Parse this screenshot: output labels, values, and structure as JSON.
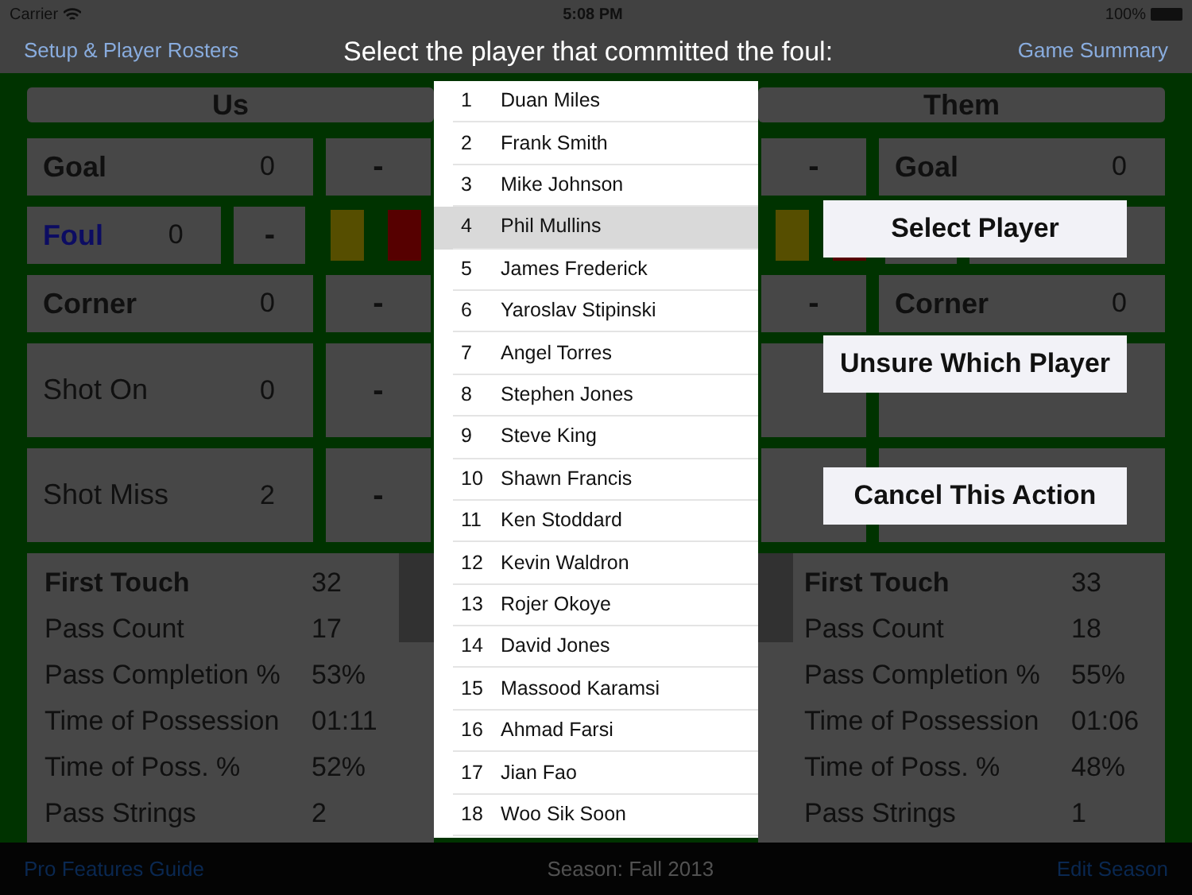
{
  "status_bar": {
    "carrier": "Carrier",
    "time": "5:08 PM",
    "battery": "100%"
  },
  "nav": {
    "left_button": "Setup & Player Rosters",
    "right_button": "Game Summary"
  },
  "us": {
    "title": "Us",
    "rows": [
      {
        "kind": "stat",
        "label": "Goal",
        "value": "0",
        "minus": "-"
      },
      {
        "kind": "foul",
        "label": "Foul",
        "value": "0",
        "minus": "-"
      },
      {
        "kind": "stat",
        "label": "Corner",
        "value": "0",
        "minus": "-"
      },
      {
        "kind": "tall",
        "label": "Shot On",
        "value": "0",
        "minus": "-"
      },
      {
        "kind": "tall",
        "label": "Shot Miss",
        "value": "2",
        "minus": "-"
      }
    ],
    "stats": [
      {
        "label": "First Touch",
        "value": "32"
      },
      {
        "label": "Pass Count",
        "value": "17"
      },
      {
        "label": "Pass Completion %",
        "value": "53%"
      },
      {
        "label": "Time of Possession",
        "value": "01:11"
      },
      {
        "label": "Time of Poss. %",
        "value": "52%"
      },
      {
        "label": "Pass Strings",
        "value": "2"
      }
    ]
  },
  "them": {
    "title": "Them",
    "rows": [
      {
        "kind": "stat",
        "label": "Goal",
        "value": "0",
        "minus": "-"
      },
      {
        "kind": "foul"
      },
      {
        "kind": "stat",
        "label": "Corner",
        "value": "0",
        "minus": "-"
      },
      {
        "kind": "tall"
      },
      {
        "kind": "tall"
      }
    ],
    "stats": [
      {
        "label": "First Touch",
        "value": "33"
      },
      {
        "label": "Pass Count",
        "value": "18"
      },
      {
        "label": "Pass Completion %",
        "value": "55%"
      },
      {
        "label": "Time of Possession",
        "value": "01:06"
      },
      {
        "label": "Time of Poss. %",
        "value": "48%"
      },
      {
        "label": "Pass Strings",
        "value": "1"
      }
    ]
  },
  "modal": {
    "title": "Select the player that committed the foul:",
    "players": [
      {
        "number": "1",
        "name": "Duan Miles",
        "selected": false
      },
      {
        "number": "2",
        "name": "Frank Smith",
        "selected": false
      },
      {
        "number": "3",
        "name": "Mike Johnson",
        "selected": false
      },
      {
        "number": "4",
        "name": "Phil Mullins",
        "selected": true
      },
      {
        "number": "5",
        "name": "James Frederick",
        "selected": false
      },
      {
        "number": "6",
        "name": "Yaroslav Stipinski",
        "selected": false
      },
      {
        "number": "7",
        "name": "Angel Torres",
        "selected": false
      },
      {
        "number": "8",
        "name": "Stephen Jones",
        "selected": false
      },
      {
        "number": "9",
        "name": "Steve King",
        "selected": false
      },
      {
        "number": "10",
        "name": "Shawn Francis",
        "selected": false
      },
      {
        "number": "11",
        "name": "Ken Stoddard",
        "selected": false
      },
      {
        "number": "12",
        "name": "Kevin Waldron",
        "selected": false
      },
      {
        "number": "13",
        "name": "Rojer Okoye",
        "selected": false
      },
      {
        "number": "14",
        "name": "David Jones",
        "selected": false
      },
      {
        "number": "15",
        "name": "Massood Karamsi",
        "selected": false
      },
      {
        "number": "16",
        "name": "Ahmad Farsi",
        "selected": false
      },
      {
        "number": "17",
        "name": "Jian Fao",
        "selected": false
      },
      {
        "number": "18",
        "name": "Woo Sik Soon",
        "selected": false
      }
    ],
    "actions": [
      "Select Player",
      "Unsure Which Player",
      "Cancel This Action"
    ]
  },
  "footer": {
    "left_link": "Pro Features Guide",
    "season": "Season: Fall 2013",
    "right_link": "Edit Season"
  }
}
